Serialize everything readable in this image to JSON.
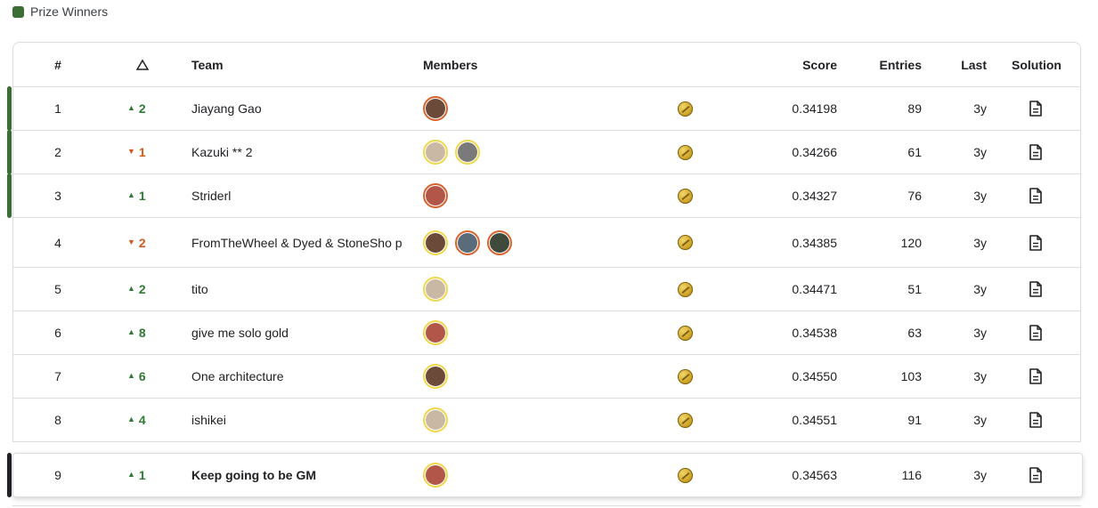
{
  "legend": {
    "label": "Prize Winners",
    "color": "#3b6e35"
  },
  "columns": {
    "rank": "#",
    "delta_icon": "triangle-outline-icon",
    "team": "Team",
    "members": "Members",
    "score": "Score",
    "entries": "Entries",
    "last": "Last",
    "solution": "Solution"
  },
  "rows": [
    {
      "rank": "1",
      "dir": "up",
      "delta": "2",
      "team": "Jiayang Gao",
      "avatars": [
        "orange"
      ],
      "score": "0.34198",
      "entries": "89",
      "last": "3y",
      "prize": true
    },
    {
      "rank": "2",
      "dir": "down",
      "delta": "1",
      "team": "Kazuki ** 2",
      "avatars": [
        "gold",
        "gold"
      ],
      "score": "0.34266",
      "entries": "61",
      "last": "3y",
      "prize": true
    },
    {
      "rank": "3",
      "dir": "up",
      "delta": "1",
      "team": "Striderl",
      "avatars": [
        "orange"
      ],
      "score": "0.34327",
      "entries": "76",
      "last": "3y",
      "prize": true
    },
    {
      "rank": "4",
      "dir": "down",
      "delta": "2",
      "team": "FromTheWheel & Dyed & StoneSho p",
      "avatars": [
        "gold",
        "orange",
        "orange"
      ],
      "score": "0.34385",
      "entries": "120",
      "last": "3y",
      "prize": false
    },
    {
      "rank": "5",
      "dir": "up",
      "delta": "2",
      "team": "tito",
      "avatars": [
        "gold"
      ],
      "score": "0.34471",
      "entries": "51",
      "last": "3y",
      "prize": false
    },
    {
      "rank": "6",
      "dir": "up",
      "delta": "8",
      "team": "give me solo gold",
      "avatars": [
        "gold"
      ],
      "score": "0.34538",
      "entries": "63",
      "last": "3y",
      "prize": false
    },
    {
      "rank": "7",
      "dir": "up",
      "delta": "6",
      "team": "One architecture",
      "avatars": [
        "gold"
      ],
      "score": "0.34550",
      "entries": "103",
      "last": "3y",
      "prize": false
    },
    {
      "rank": "8",
      "dir": "up",
      "delta": "4",
      "team": "ishikei",
      "avatars": [
        "gold"
      ],
      "score": "0.34551",
      "entries": "91",
      "last": "3y",
      "prize": false
    }
  ],
  "self_row": {
    "rank": "9",
    "dir": "up",
    "delta": "1",
    "team": "Keep going to be GM",
    "avatars": [
      "gold"
    ],
    "score": "0.34563",
    "entries": "116",
    "last": "3y"
  },
  "medal_icon": "gold-medal-icon",
  "solution_icon": "document-icon"
}
